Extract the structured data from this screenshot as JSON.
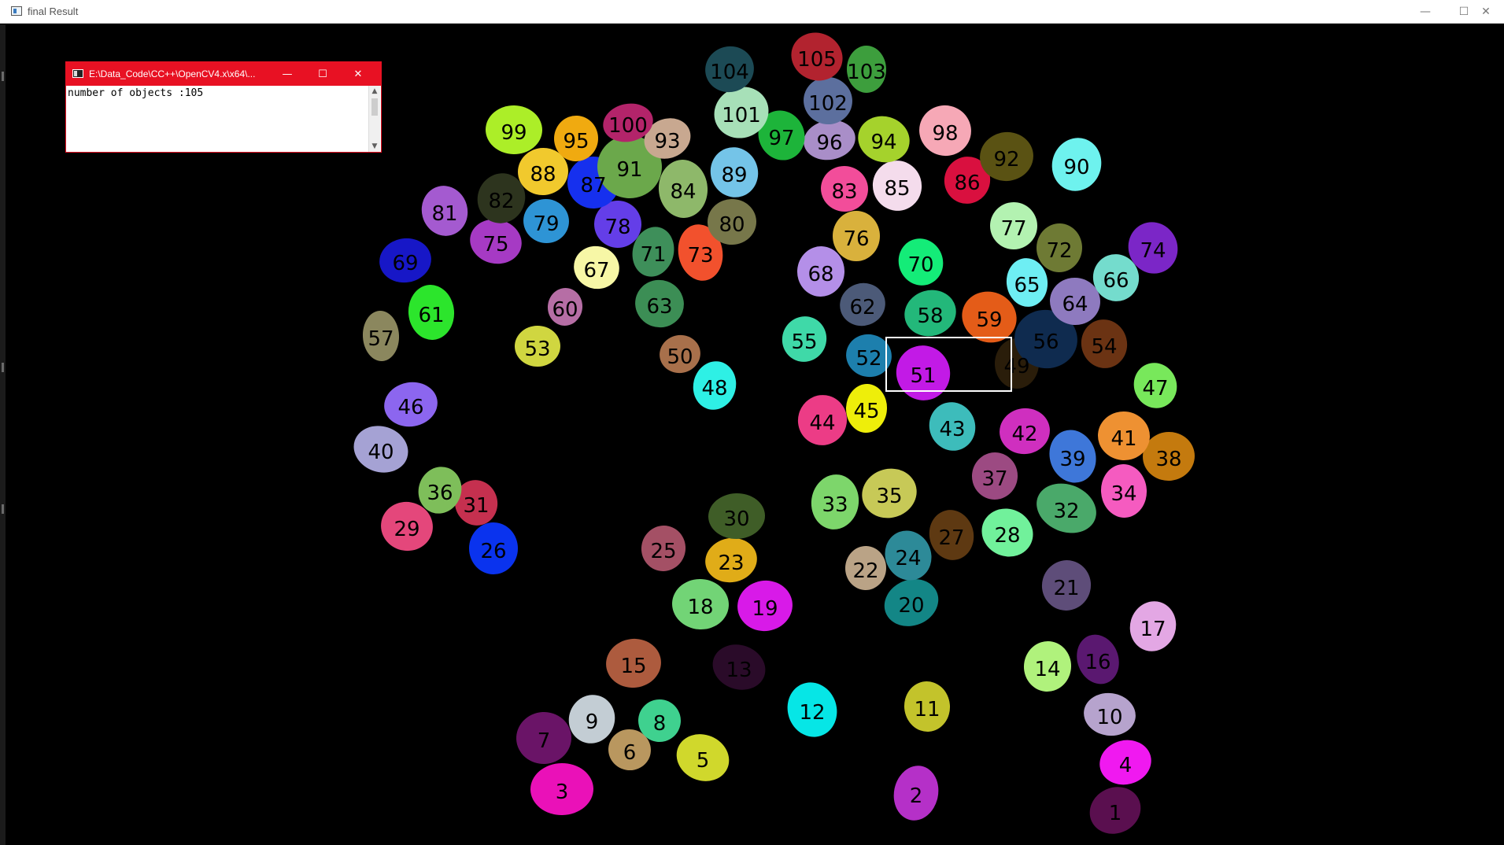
{
  "window": {
    "title": "final Result",
    "minimize_glyph": "—",
    "maximize_glyph": "☐",
    "close_glyph": "✕"
  },
  "console": {
    "title": "E:\\Data_Code\\CC++\\OpenCV4.x\\x64\\...",
    "output": "number of objects :105",
    "minimize_glyph": "—",
    "maximize_glyph": "☐",
    "close_glyph": "✕",
    "accent": "#e81123"
  },
  "objects": [
    {
      "id": "1",
      "color": "#5a0f4f"
    },
    {
      "id": "2",
      "color": "#b530c8"
    },
    {
      "id": "3",
      "color": "#ea11b8"
    },
    {
      "id": "4",
      "color": "#f019f0"
    },
    {
      "id": "5",
      "color": "#d0d82c"
    },
    {
      "id": "6",
      "color": "#b9975f"
    },
    {
      "id": "7",
      "color": "#6a1467"
    },
    {
      "id": "8",
      "color": "#3fd18f"
    },
    {
      "id": "9",
      "color": "#c3cdd4"
    },
    {
      "id": "10",
      "color": "#b6a3cd"
    },
    {
      "id": "11",
      "color": "#c3c32b"
    },
    {
      "id": "12",
      "color": "#06e6e6"
    },
    {
      "id": "13",
      "color": "#2a0b29"
    },
    {
      "id": "14",
      "color": "#b0f27c"
    },
    {
      "id": "15",
      "color": "#ad5b3e"
    },
    {
      "id": "16",
      "color": "#5a1870"
    },
    {
      "id": "17",
      "color": "#e3a7e4"
    },
    {
      "id": "18",
      "color": "#72d476"
    },
    {
      "id": "19",
      "color": "#d81ae8"
    },
    {
      "id": "20",
      "color": "#138686"
    },
    {
      "id": "21",
      "color": "#5e4d79"
    },
    {
      "id": "22",
      "color": "#baa386"
    },
    {
      "id": "23",
      "color": "#e0ac18"
    },
    {
      "id": "24",
      "color": "#2d8a98"
    },
    {
      "id": "25",
      "color": "#a45065"
    },
    {
      "id": "26",
      "color": "#0a33ee"
    },
    {
      "id": "27",
      "color": "#5e3912"
    },
    {
      "id": "28",
      "color": "#71f19b"
    },
    {
      "id": "29",
      "color": "#e4477b"
    },
    {
      "id": "30",
      "color": "#3f5d27"
    },
    {
      "id": "31",
      "color": "#c5304f"
    },
    {
      "id": "32",
      "color": "#4aa96a"
    },
    {
      "id": "33",
      "color": "#7dd66b"
    },
    {
      "id": "34",
      "color": "#f55bc0"
    },
    {
      "id": "35",
      "color": "#c7c957"
    },
    {
      "id": "36",
      "color": "#7ebe5a"
    },
    {
      "id": "37",
      "color": "#9c4a82"
    },
    {
      "id": "38",
      "color": "#c47a0e"
    },
    {
      "id": "39",
      "color": "#3e77d9"
    },
    {
      "id": "40",
      "color": "#a5a2d4"
    },
    {
      "id": "41",
      "color": "#ee9132"
    },
    {
      "id": "42",
      "color": "#cf2fbf"
    },
    {
      "id": "43",
      "color": "#3dbcbb"
    },
    {
      "id": "44",
      "color": "#ec3c86"
    },
    {
      "id": "45",
      "color": "#eeee0a"
    },
    {
      "id": "46",
      "color": "#8c66ef"
    },
    {
      "id": "47",
      "color": "#78e85b"
    },
    {
      "id": "48",
      "color": "#2ef0e5"
    },
    {
      "id": "49",
      "color": "#2a1d0a"
    },
    {
      "id": "50",
      "color": "#a8704b"
    },
    {
      "id": "51",
      "color": "#c21ae6"
    },
    {
      "id": "52",
      "color": "#1d7fad"
    },
    {
      "id": "53",
      "color": "#d0d640"
    },
    {
      "id": "54",
      "color": "#6b3313"
    },
    {
      "id": "55",
      "color": "#3fd9a8"
    },
    {
      "id": "56",
      "color": "#0f2b4f"
    },
    {
      "id": "57",
      "color": "#8b875e"
    },
    {
      "id": "58",
      "color": "#23b87a"
    },
    {
      "id": "59",
      "color": "#e45c18"
    },
    {
      "id": "60",
      "color": "#b66ea5"
    },
    {
      "id": "61",
      "color": "#2ce52c"
    },
    {
      "id": "62",
      "color": "#4c5a78"
    },
    {
      "id": "63",
      "color": "#3c8e55"
    },
    {
      "id": "64",
      "color": "#8e7abf"
    },
    {
      "id": "65",
      "color": "#6eeef3"
    },
    {
      "id": "66",
      "color": "#74dccd"
    },
    {
      "id": "67",
      "color": "#f7f7a6"
    },
    {
      "id": "68",
      "color": "#b48fe8"
    },
    {
      "id": "69",
      "color": "#1717c7"
    },
    {
      "id": "70",
      "color": "#14ec78"
    },
    {
      "id": "71",
      "color": "#3e8f5a"
    },
    {
      "id": "72",
      "color": "#6e7a34"
    },
    {
      "id": "73",
      "color": "#f2512d"
    },
    {
      "id": "74",
      "color": "#7b26c7"
    },
    {
      "id": "75",
      "color": "#a63ac4"
    },
    {
      "id": "76",
      "color": "#d9b13c"
    },
    {
      "id": "77",
      "color": "#b3f2b1"
    },
    {
      "id": "78",
      "color": "#643ee8"
    },
    {
      "id": "79",
      "color": "#2e94d5"
    },
    {
      "id": "80",
      "color": "#77774a"
    },
    {
      "id": "81",
      "color": "#a45ad0"
    },
    {
      "id": "82",
      "color": "#2d341e"
    },
    {
      "id": "83",
      "color": "#f24d9a"
    },
    {
      "id": "84",
      "color": "#8eb86a"
    },
    {
      "id": "85",
      "color": "#f4dcec"
    },
    {
      "id": "86",
      "color": "#d9103f"
    },
    {
      "id": "87",
      "color": "#1630ee"
    },
    {
      "id": "88",
      "color": "#f1c92d"
    },
    {
      "id": "89",
      "color": "#74c4e8"
    },
    {
      "id": "90",
      "color": "#6ef2ee"
    },
    {
      "id": "91",
      "color": "#6ba84b"
    },
    {
      "id": "92",
      "color": "#5a5213"
    },
    {
      "id": "93",
      "color": "#c8a890"
    },
    {
      "id": "94",
      "color": "#a5d22c"
    },
    {
      "id": "95",
      "color": "#f0aa10"
    },
    {
      "id": "96",
      "color": "#a98ec8"
    },
    {
      "id": "97",
      "color": "#1db43a"
    },
    {
      "id": "98",
      "color": "#f6a8b6"
    },
    {
      "id": "99",
      "color": "#acee28"
    },
    {
      "id": "100",
      "color": "#b3246a"
    },
    {
      "id": "101",
      "color": "#a7e0b8"
    },
    {
      "id": "102",
      "color": "#5c6f9e"
    },
    {
      "id": "103",
      "color": "#3d9e3d"
    },
    {
      "id": "104",
      "color": "#1c4a55"
    },
    {
      "id": "105",
      "color": "#b2232f"
    }
  ]
}
